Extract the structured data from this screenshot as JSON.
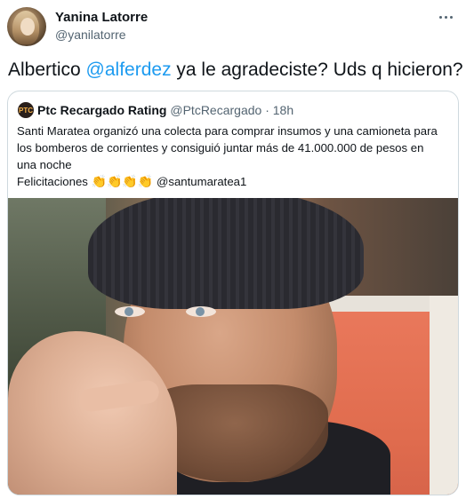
{
  "author": {
    "name": "Yanina Latorre",
    "handle": "@yanilatorre",
    "avatar_icon": "profile-photo"
  },
  "tweet": {
    "text_before": "Albertico ",
    "mention": "@alferdez",
    "text_after": " ya le agradeciste? Uds q hicieron?"
  },
  "more_icon": "more-horizontal-icon",
  "quote": {
    "avatar_text": "PTC",
    "name": "Ptc Recargado Rating",
    "handle": "@PtcRecargado",
    "separator": " · ",
    "time": "18h",
    "line1": "Santi Maratea organizó una colecta para comprar insumos y una camioneta para",
    "line2": "los bomberos de corrientes y consiguió juntar más de 41.000.000 de pesos en",
    "line3": "una noche",
    "line4_text": "Felicitaciones ",
    "claps": "👏👏👏👏",
    "line4_mention": " @santumaratea1",
    "photo_icon": "portrait-photo"
  },
  "colors": {
    "accent": "#1d9bf0",
    "text": "#0f1419",
    "secondary": "#536471",
    "border": "#cfd9de"
  }
}
